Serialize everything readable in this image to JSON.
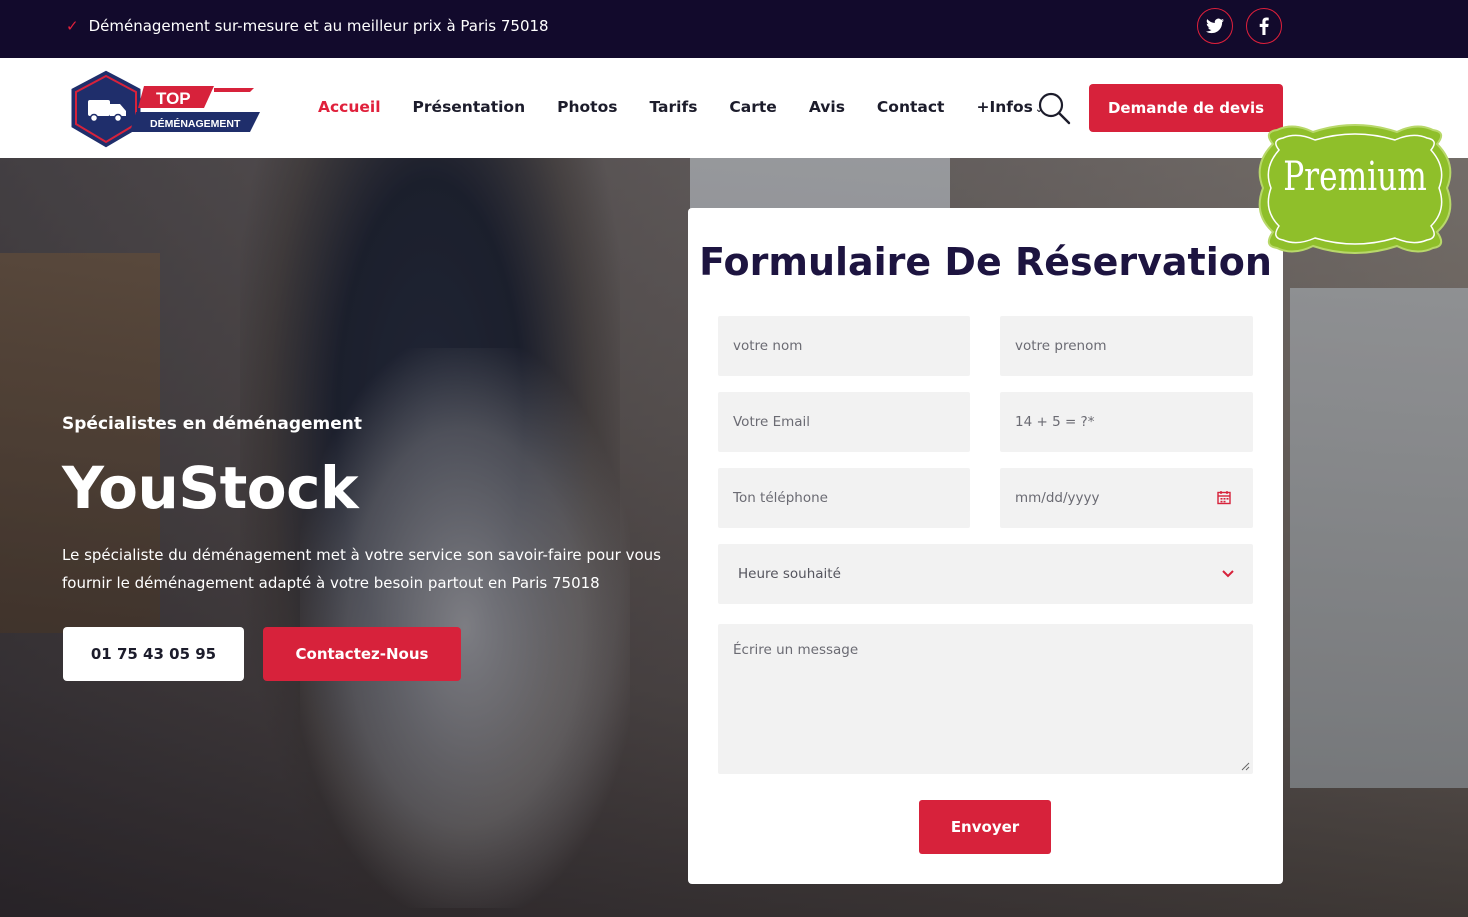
{
  "topbar": {
    "tagline": "Déménagement sur-mesure et au meilleur prix à Paris 75018",
    "social": [
      "twitter-icon",
      "facebook-icon"
    ]
  },
  "brand": {
    "logo_top": "TOP",
    "logo_bottom": "DÉMÉNAGEMENT"
  },
  "nav": {
    "items": [
      {
        "label": "Accueil",
        "active": true
      },
      {
        "label": "Présentation"
      },
      {
        "label": "Photos"
      },
      {
        "label": "Tarifs"
      },
      {
        "label": "Carte"
      },
      {
        "label": "Avis"
      },
      {
        "label": "Contact"
      },
      {
        "label": "+Infos",
        "dropdown": true
      }
    ],
    "cta": "Demande de devis"
  },
  "badge": {
    "label": "Premium"
  },
  "hero": {
    "eyebrow": "Spécialistes en déménagement",
    "title": "YouStock",
    "description": "Le spécialiste du déménagement met à votre service son savoir-faire pour vous fournir le déménagement adapté à votre besoin partout en Paris 75018",
    "phone": "01 75 43 05 95",
    "contact_cta": "Contactez-Nous"
  },
  "form": {
    "title": "Formulaire De Réservation",
    "nom_placeholder": "votre nom",
    "prenom_placeholder": "votre prenom",
    "email_placeholder": "Votre Email",
    "captcha_placeholder": "14 + 5 = ?*",
    "tel_placeholder": "Ton téléphone",
    "date_placeholder": "mm/dd/yyyy",
    "heure_selected": "Heure souhaité",
    "message_placeholder": "Écrire un message",
    "submit": "Envoyer"
  },
  "colors": {
    "accent": "#d7223b",
    "dark": "#120a2c",
    "badge": "#8fbf2a"
  }
}
